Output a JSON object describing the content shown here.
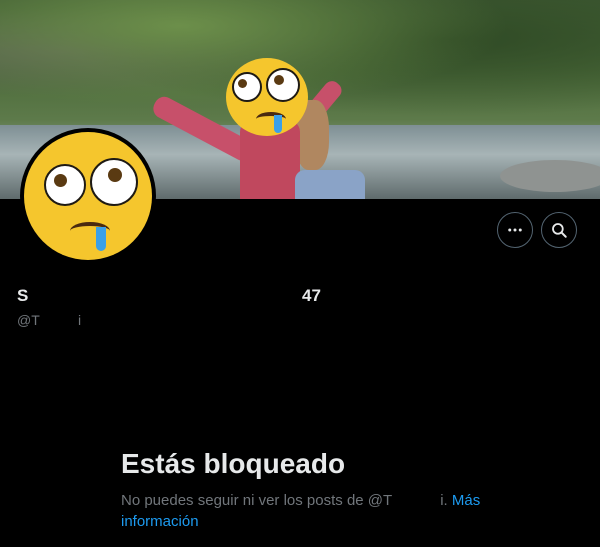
{
  "profile": {
    "display_name_start": "S",
    "display_name_end": "47",
    "handle_start": "@T",
    "handle_end": "i"
  },
  "header": {
    "more_icon": "more-horizontal-icon",
    "search_icon": "search-icon"
  },
  "blocked": {
    "title": "Estás bloqueado",
    "text_before": "No puedes seguir ni ver los posts de @T",
    "text_after": "i.",
    "link_label": "Más información"
  },
  "colors": {
    "background": "#000000",
    "text_primary": "#e7e9ea",
    "text_secondary": "#71767b",
    "link": "#1d9bf0",
    "button_border": "#536471"
  }
}
